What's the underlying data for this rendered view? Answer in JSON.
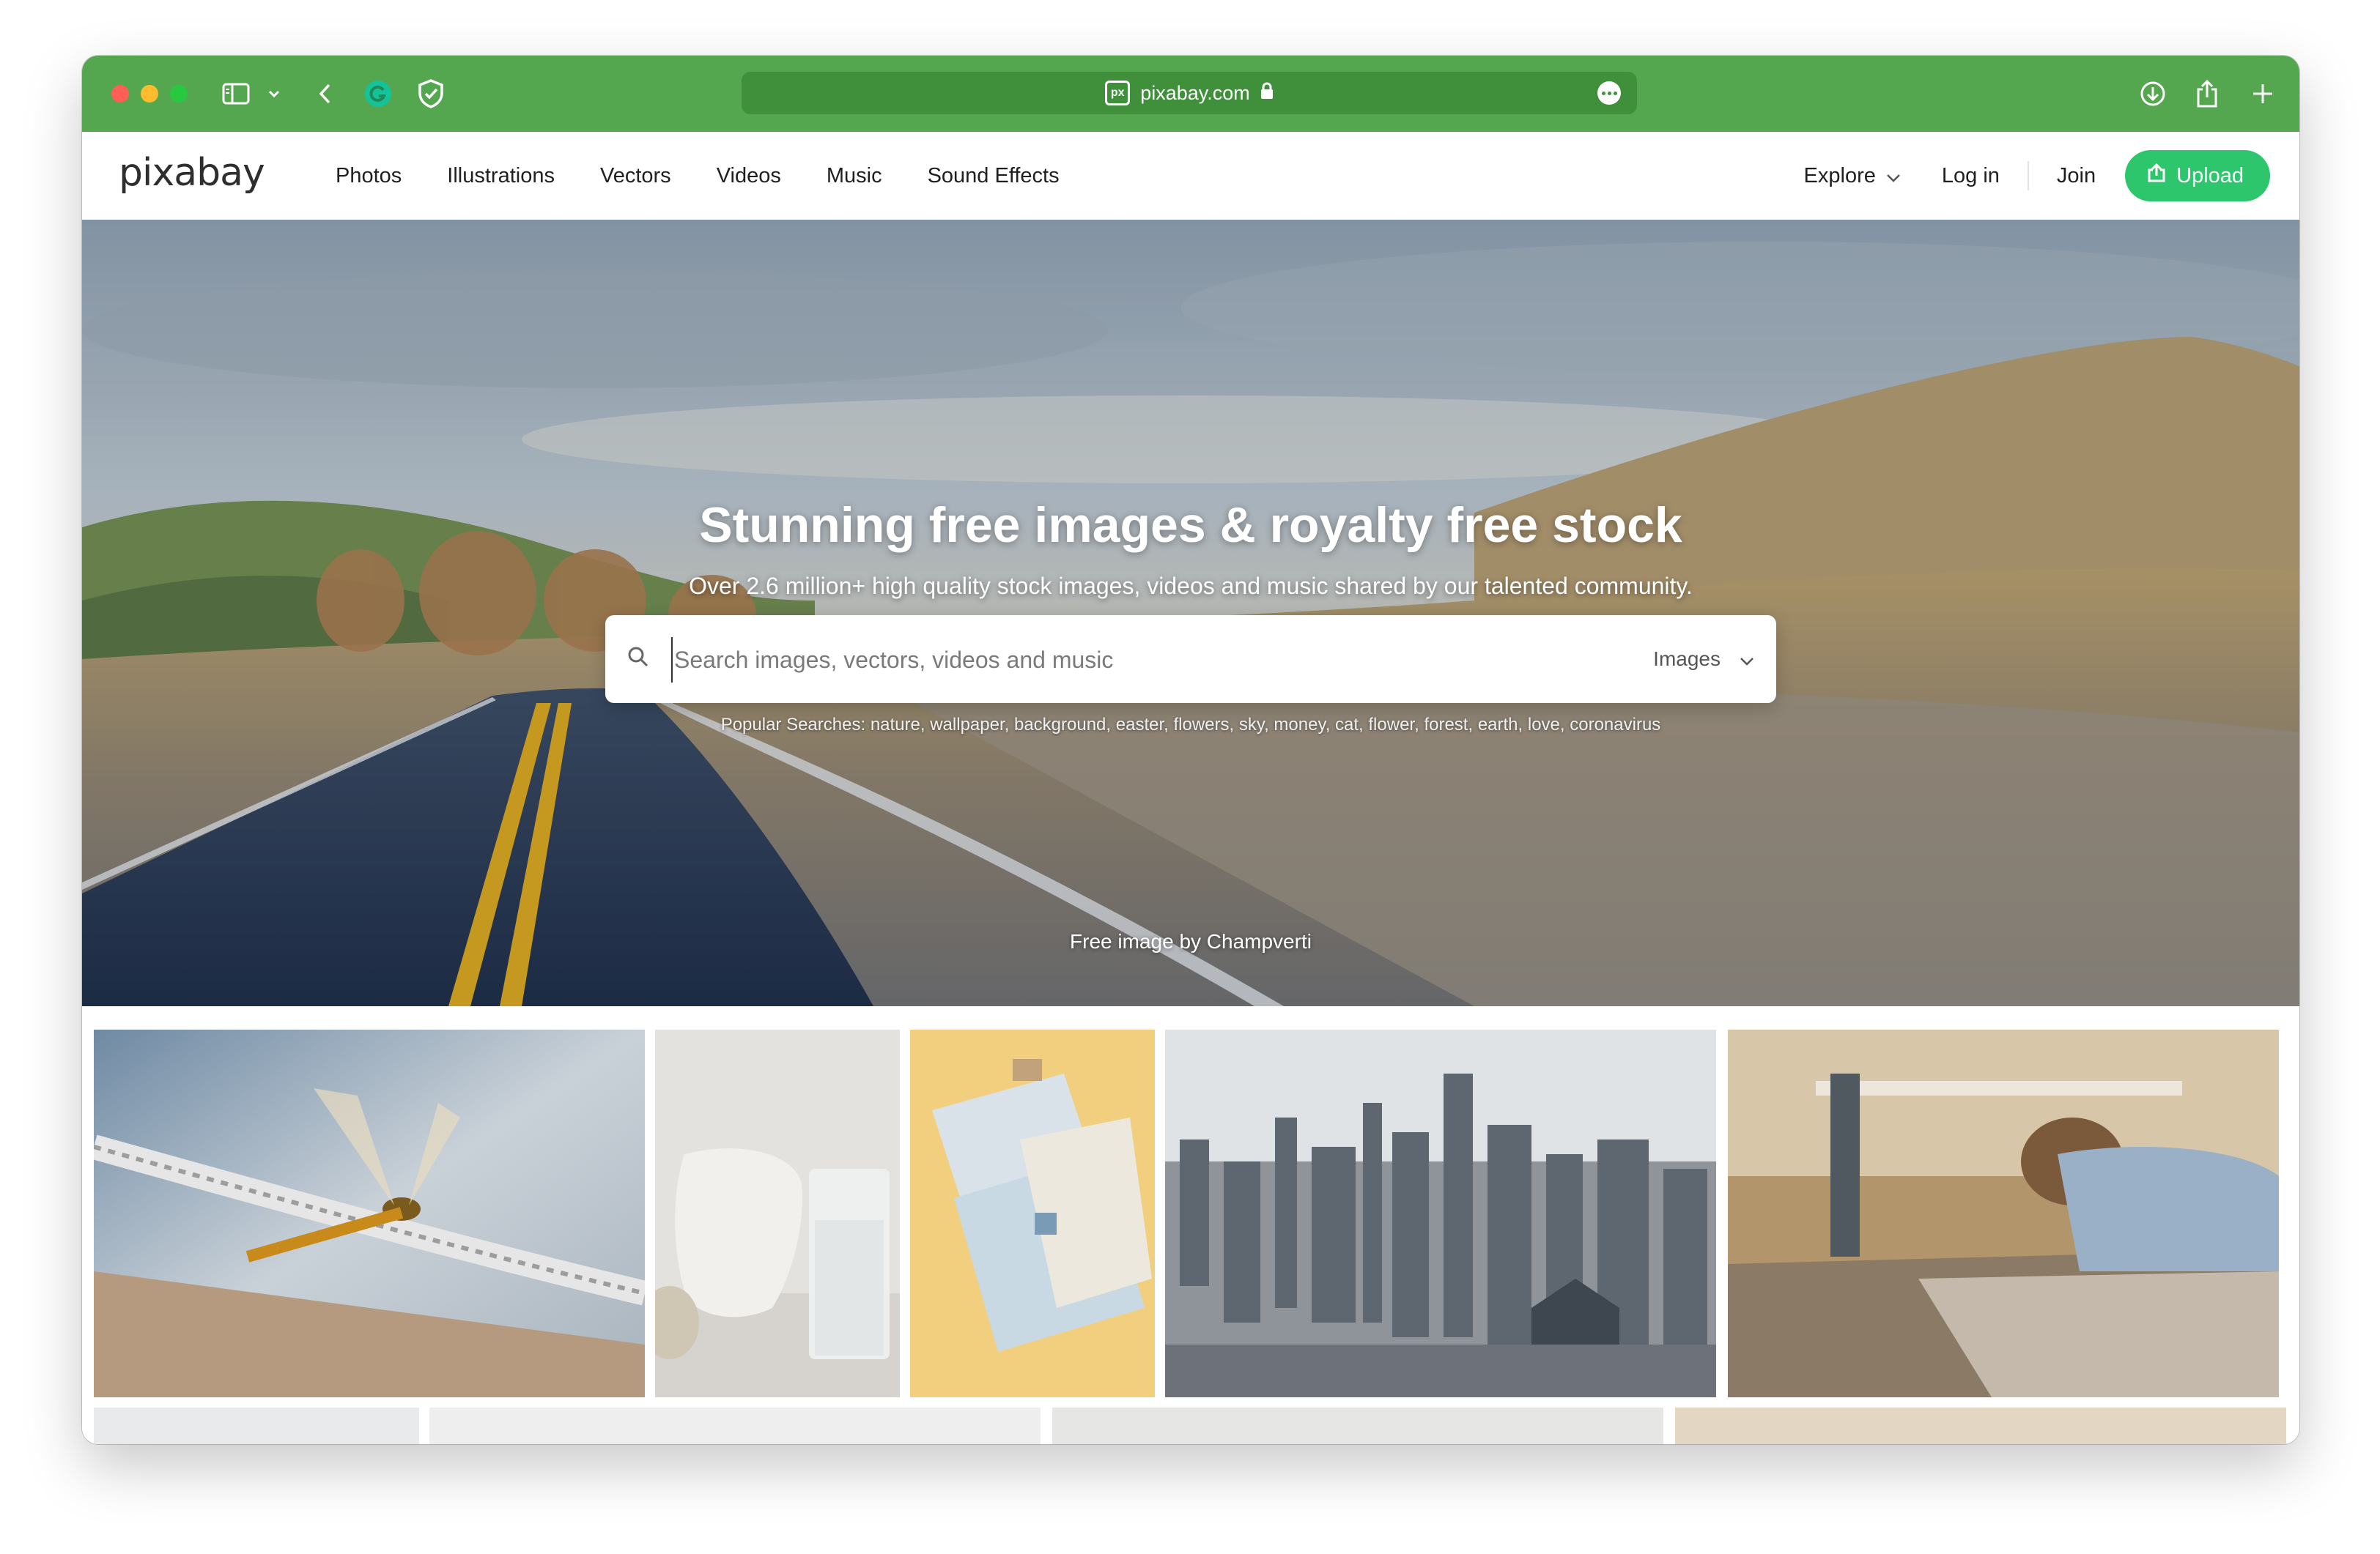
{
  "browser": {
    "url": "pixabay.com",
    "favicon_text": "px",
    "toolbar_icons": [
      "sidebar-icon",
      "chevron-down-icon",
      "back-icon",
      "grammarly-icon",
      "shield-icon",
      "download-icon",
      "share-icon",
      "new-tab-icon"
    ],
    "theme_color": "#54a64f"
  },
  "site": {
    "logo": "pixabay",
    "nav": [
      "Photos",
      "Illustrations",
      "Vectors",
      "Videos",
      "Music",
      "Sound Effects"
    ],
    "explore": "Explore",
    "login": "Log in",
    "join": "Join",
    "upload": "Upload",
    "accent": "#2ec66d"
  },
  "hero": {
    "title": "Stunning free images & royalty free stock",
    "subtitle": "Over 2.6 million+ high quality stock images, videos and music shared by our talented community.",
    "search_placeholder": "Search images, vectors, videos and music",
    "search_type": "Images",
    "popular_label": "Popular Searches:",
    "popular_terms": [
      "nature",
      "wallpaper",
      "background",
      "easter",
      "flowers",
      "sky",
      "money",
      "cat",
      "flower",
      "forest",
      "earth",
      "love",
      "coronavirus"
    ],
    "credit": "Free image by Champverti"
  }
}
